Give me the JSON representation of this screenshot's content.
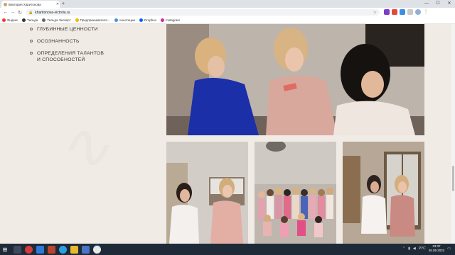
{
  "browser": {
    "tab_title": "Виктория Харитонова",
    "new_tab": "+",
    "url": "kharitonova-victoria.ru",
    "window_controls": [
      "—",
      "☐",
      "✕"
    ],
    "bookmarks": [
      {
        "label": "Яндекс",
        "color": "#ff3333"
      },
      {
        "label": "Тильда",
        "color": "#333333"
      },
      {
        "label": "Тильда Эксперт",
        "color": "#666666"
      },
      {
        "label": "Предпринимателя...",
        "color": "#f2b705"
      },
      {
        "label": "Аннотации",
        "color": "#4a90d9"
      },
      {
        "label": "Dropbox",
        "color": "#0061ff"
      },
      {
        "label": "Instagram",
        "color": "#d6249f"
      }
    ]
  },
  "content": {
    "list": [
      {
        "lines": [
          "ГЛУБИННЫЕ ЦЕННОСТИ"
        ]
      },
      {
        "lines": [
          "ОСОЗНАННОСТЬ"
        ]
      },
      {
        "lines": [
          "ОПРЕДЕЛЕНИЯ ТАЛАНТОВ",
          "И СПОСОБНОСТЕЙ"
        ]
      }
    ]
  },
  "taskbar": {
    "lang": "РУС",
    "time": "23:37",
    "date": "26.09.2022"
  },
  "colors": {
    "page_bg": "#f0ece5",
    "text": "#3a3530",
    "taskbar": "#1f2a38"
  }
}
